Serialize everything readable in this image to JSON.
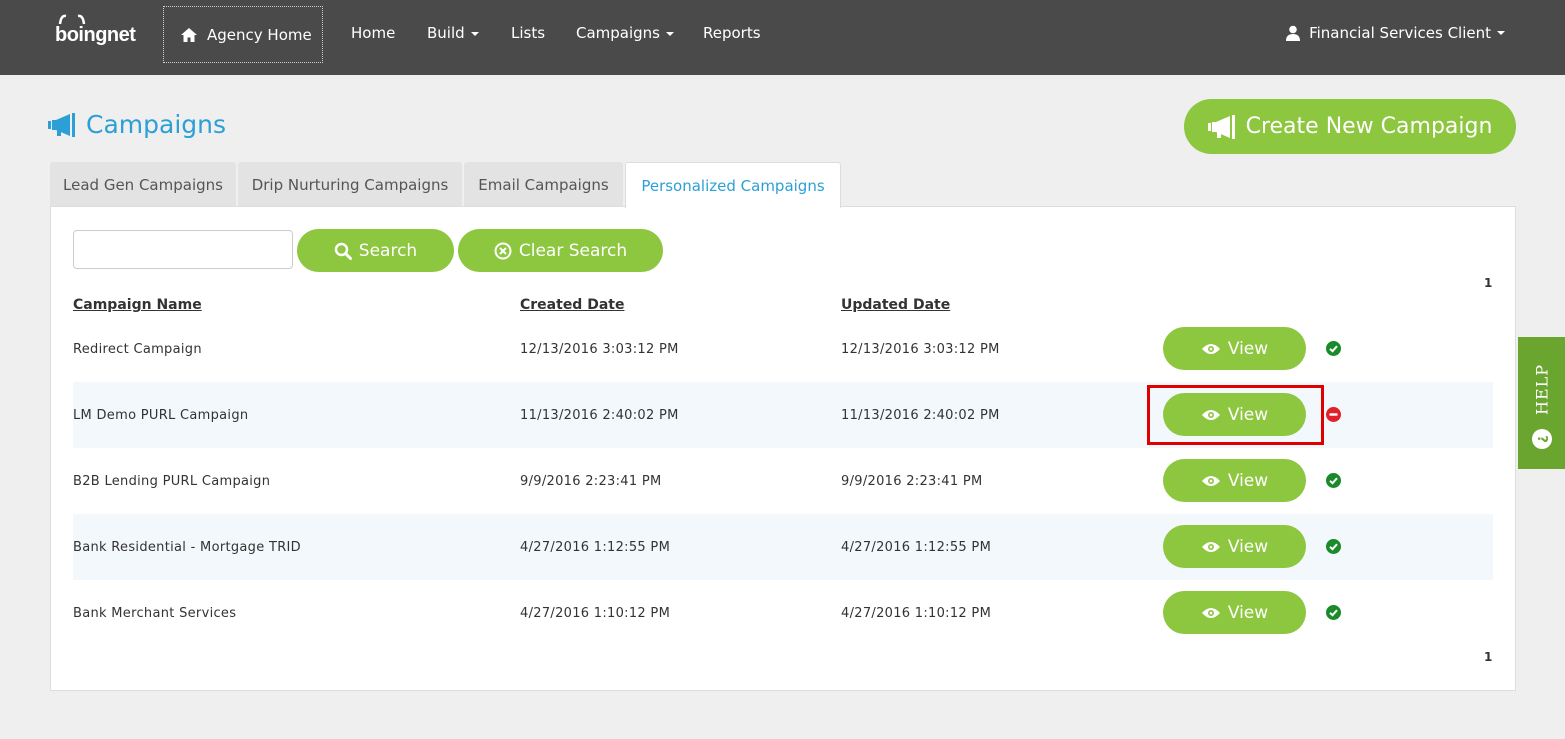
{
  "nav": {
    "logo_text": "boingnet",
    "agency_home": "Agency Home",
    "items": [
      {
        "label": "Home",
        "dropdown": false
      },
      {
        "label": "Build",
        "dropdown": true
      },
      {
        "label": "Lists",
        "dropdown": false
      },
      {
        "label": "Campaigns",
        "dropdown": true
      },
      {
        "label": "Reports",
        "dropdown": false
      }
    ],
    "user": "Financial Services Client"
  },
  "page": {
    "title": "Campaigns",
    "create_button": "Create New Campaign"
  },
  "tabs": [
    {
      "label": "Lead Gen Campaigns",
      "active": false
    },
    {
      "label": "Drip Nurturing Campaigns",
      "active": false
    },
    {
      "label": "Email Campaigns",
      "active": false
    },
    {
      "label": "Personalized Campaigns",
      "active": true
    }
  ],
  "search": {
    "value": "",
    "placeholder": "",
    "search_button": "Search",
    "clear_button": "Clear Search"
  },
  "pagination": {
    "top": "1",
    "bottom": "1"
  },
  "table": {
    "columns": [
      "Campaign Name",
      "Created Date",
      "Updated Date"
    ],
    "view_label": "View",
    "rows": [
      {
        "name": "Redirect Campaign",
        "created": "12/13/2016 3:03:12 PM",
        "updated": "12/13/2016 3:03:12 PM",
        "status": "active"
      },
      {
        "name": "LM Demo PURL Campaign",
        "created": "11/13/2016 2:40:02 PM",
        "updated": "11/13/2016 2:40:02 PM",
        "status": "inactive"
      },
      {
        "name": "B2B Lending PURL Campaign",
        "created": "9/9/2016 2:23:41 PM",
        "updated": "9/9/2016 2:23:41 PM",
        "status": "active"
      },
      {
        "name": "Bank Residential - Mortgage TRID",
        "created": "4/27/2016 1:12:55 PM",
        "updated": "4/27/2016 1:12:55 PM",
        "status": "active"
      },
      {
        "name": "Bank Merchant Services",
        "created": "4/27/2016 1:10:12 PM",
        "updated": "4/27/2016 1:10:12 PM",
        "status": "active"
      }
    ]
  },
  "help": {
    "label": "HELP"
  },
  "colors": {
    "nav_bg": "#4a4a4a",
    "accent_blue": "#2ca0d6",
    "button_green": "#8dc63f",
    "status_ok": "#1a8a2a",
    "status_off": "#e0202a",
    "highlight_red": "#e00000"
  }
}
